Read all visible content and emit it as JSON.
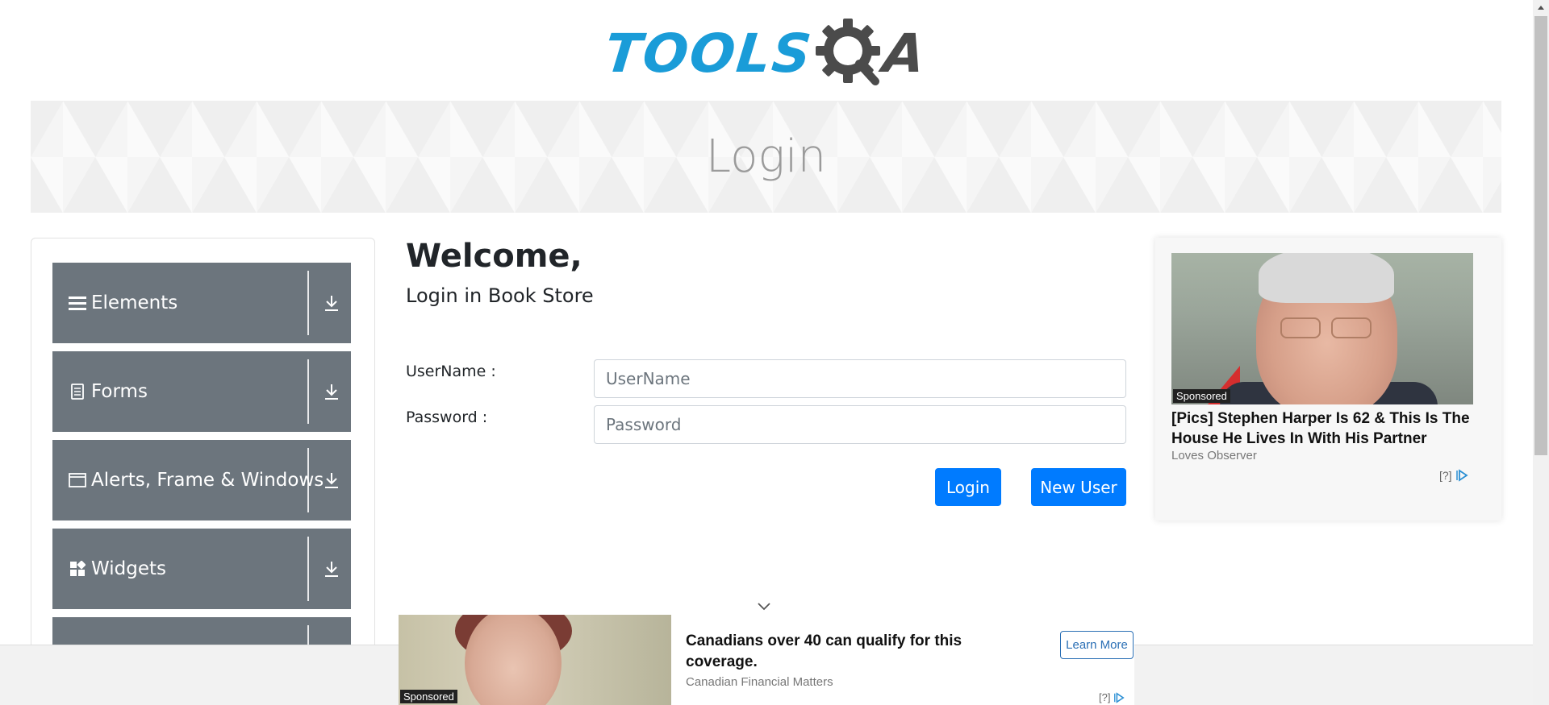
{
  "header": {
    "logo_text_left": "TOOLS",
    "logo_text_right": "A",
    "logo_icon": "gear-qa-logo-icon"
  },
  "banner": {
    "title": "Login"
  },
  "sidebar": {
    "groups": [
      {
        "label": "Elements",
        "icon": "menu-lines-icon"
      },
      {
        "label": "Forms",
        "icon": "document-icon"
      },
      {
        "label": "Alerts, Frame & Windows",
        "icon": "window-icon"
      },
      {
        "label": "Widgets",
        "icon": "widgets-grid-icon"
      },
      {
        "label": "",
        "icon": ""
      }
    ]
  },
  "main": {
    "welcome": "Welcome,",
    "subtitle": "Login in Book Store",
    "username_label": "UserName :",
    "username_placeholder": "UserName",
    "password_label": "Password :",
    "password_placeholder": "Password",
    "login_button": "Login",
    "new_user_button": "New User"
  },
  "ad_right": {
    "sponsored": "Sponsored",
    "title": "[Pics] Stephen Harper Is 62 & This Is The House He Lives In With His Partner",
    "source": "Loves Observer",
    "info": "[?]"
  },
  "ad_bottom": {
    "sponsored": "Sponsored",
    "title": "Canadians over 40 can qualify for this coverage.",
    "source": "Canadian Financial Matters",
    "cta": "Learn More",
    "info": "[?]"
  },
  "colors": {
    "primary": "#007bff",
    "sidebar_group": "#6c757d",
    "logo_blue": "#1a9cd8",
    "logo_dark": "#4b4b4b"
  }
}
